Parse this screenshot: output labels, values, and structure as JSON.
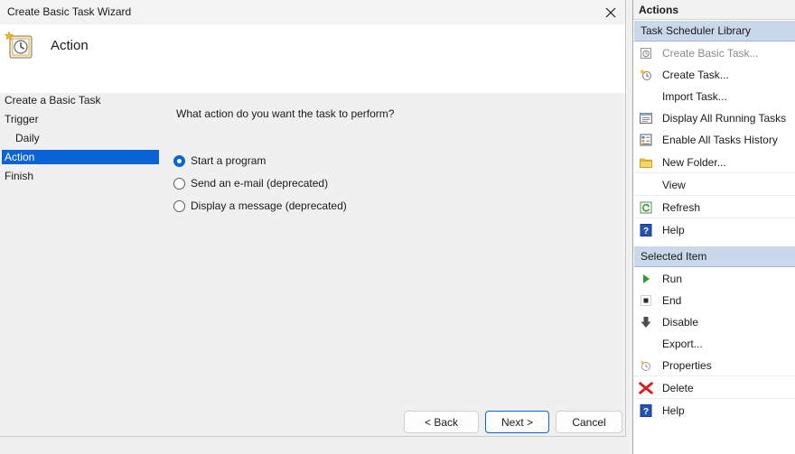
{
  "wizard": {
    "window_title": "Create Basic Task Wizard",
    "header_title": "Action",
    "steps": [
      {
        "label": "Create a Basic Task"
      },
      {
        "label": "Trigger"
      },
      {
        "label": "Daily"
      },
      {
        "label": "Action"
      },
      {
        "label": "Finish"
      }
    ],
    "active_step": "Action",
    "question": "What action do you want the task to perform?",
    "options": [
      {
        "label": "Start a program",
        "checked": true
      },
      {
        "label": "Send an e-mail (deprecated)",
        "checked": false
      },
      {
        "label": "Display a message (deprecated)",
        "checked": false
      }
    ],
    "buttons": {
      "back": "< Back",
      "next": "Next >",
      "cancel": "Cancel"
    }
  },
  "actions_pane": {
    "title": "Actions",
    "library_section": "Task Scheduler Library",
    "library_items": [
      {
        "label": "Create Basic Task...",
        "icon": "create-basic-task-icon",
        "enabled": false
      },
      {
        "label": "Create Task...",
        "icon": "create-task-icon",
        "enabled": true
      },
      {
        "label": "Import Task...",
        "icon": "",
        "enabled": true
      },
      {
        "label": "Display All Running Tasks",
        "icon": "running-tasks-icon",
        "enabled": true
      },
      {
        "label": "Enable All Tasks History",
        "icon": "tasks-history-icon",
        "enabled": true
      },
      {
        "label": "New Folder...",
        "icon": "folder-icon",
        "enabled": true
      },
      {
        "label": "View",
        "icon": "",
        "enabled": true
      },
      {
        "label": "Refresh",
        "icon": "refresh-icon",
        "enabled": true
      },
      {
        "label": "Help",
        "icon": "help-icon",
        "enabled": true
      }
    ],
    "selected_section": "Selected Item",
    "selected_items": [
      {
        "label": "Run",
        "icon": "run-icon"
      },
      {
        "label": "End",
        "icon": "end-icon"
      },
      {
        "label": "Disable",
        "icon": "disable-icon"
      },
      {
        "label": "Export...",
        "icon": ""
      },
      {
        "label": "Properties",
        "icon": "properties-icon"
      },
      {
        "label": "Delete",
        "icon": "delete-icon"
      },
      {
        "label": "Help",
        "icon": "help-icon"
      }
    ]
  },
  "colors": {
    "accent": "#0a64d6",
    "section_header": "#c9d8ea",
    "delete_red": "#d42020",
    "run_green": "#2d9d2d",
    "help_blue": "#2451b5"
  }
}
